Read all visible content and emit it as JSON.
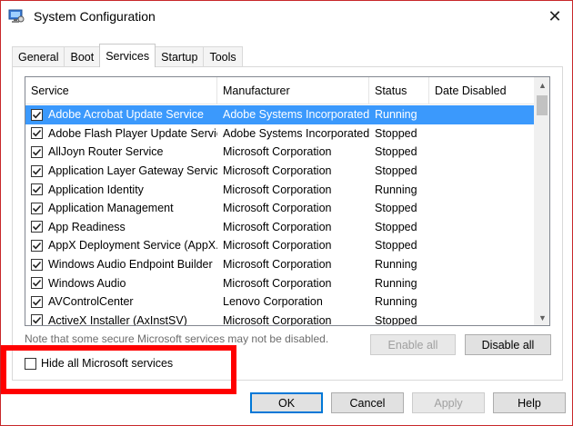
{
  "window": {
    "title": "System Configuration",
    "app_icon": "system-config-icon",
    "close_glyph": "✕"
  },
  "tabs": [
    {
      "label": "General",
      "active": false
    },
    {
      "label": "Boot",
      "active": false
    },
    {
      "label": "Services",
      "active": true
    },
    {
      "label": "Startup",
      "active": false
    },
    {
      "label": "Tools",
      "active": false
    }
  ],
  "table": {
    "headers": {
      "service": "Service",
      "manufacturer": "Manufacturer",
      "status": "Status",
      "date_disabled": "Date Disabled"
    },
    "rows": [
      {
        "checked": true,
        "service": "Adobe Acrobat Update Service",
        "manufacturer": "Adobe Systems Incorporated",
        "status": "Running",
        "date_disabled": "",
        "selected": true
      },
      {
        "checked": true,
        "service": "Adobe Flash Player Update Service",
        "manufacturer": "Adobe Systems Incorporated",
        "status": "Stopped",
        "date_disabled": "",
        "selected": false
      },
      {
        "checked": true,
        "service": "AllJoyn Router Service",
        "manufacturer": "Microsoft Corporation",
        "status": "Stopped",
        "date_disabled": "",
        "selected": false
      },
      {
        "checked": true,
        "service": "Application Layer Gateway Service",
        "manufacturer": "Microsoft Corporation",
        "status": "Stopped",
        "date_disabled": "",
        "selected": false
      },
      {
        "checked": true,
        "service": "Application Identity",
        "manufacturer": "Microsoft Corporation",
        "status": "Running",
        "date_disabled": "",
        "selected": false
      },
      {
        "checked": true,
        "service": "Application Management",
        "manufacturer": "Microsoft Corporation",
        "status": "Stopped",
        "date_disabled": "",
        "selected": false
      },
      {
        "checked": true,
        "service": "App Readiness",
        "manufacturer": "Microsoft Corporation",
        "status": "Stopped",
        "date_disabled": "",
        "selected": false
      },
      {
        "checked": true,
        "service": "AppX Deployment Service (AppX...",
        "manufacturer": "Microsoft Corporation",
        "status": "Stopped",
        "date_disabled": "",
        "selected": false
      },
      {
        "checked": true,
        "service": "Windows Audio Endpoint Builder",
        "manufacturer": "Microsoft Corporation",
        "status": "Running",
        "date_disabled": "",
        "selected": false
      },
      {
        "checked": true,
        "service": "Windows Audio",
        "manufacturer": "Microsoft Corporation",
        "status": "Running",
        "date_disabled": "",
        "selected": false
      },
      {
        "checked": true,
        "service": "AVControlCenter",
        "manufacturer": "Lenovo Corporation",
        "status": "Running",
        "date_disabled": "",
        "selected": false
      },
      {
        "checked": true,
        "service": "ActiveX Installer (AxInstSV)",
        "manufacturer": "Microsoft Corporation",
        "status": "Stopped",
        "date_disabled": "",
        "selected": false
      }
    ]
  },
  "note": "Note that some secure Microsoft services may not be disabled.",
  "buttons": {
    "enable_all": "Enable all",
    "disable_all": "Disable all",
    "ok": "OK",
    "cancel": "Cancel",
    "apply": "Apply",
    "help": "Help"
  },
  "hide_ms": {
    "label": "Hide all Microsoft services",
    "checked": false
  },
  "colors": {
    "selection": "#3b99fc",
    "highlight_box": "#ff0000",
    "default_button_border": "#0078d7"
  }
}
